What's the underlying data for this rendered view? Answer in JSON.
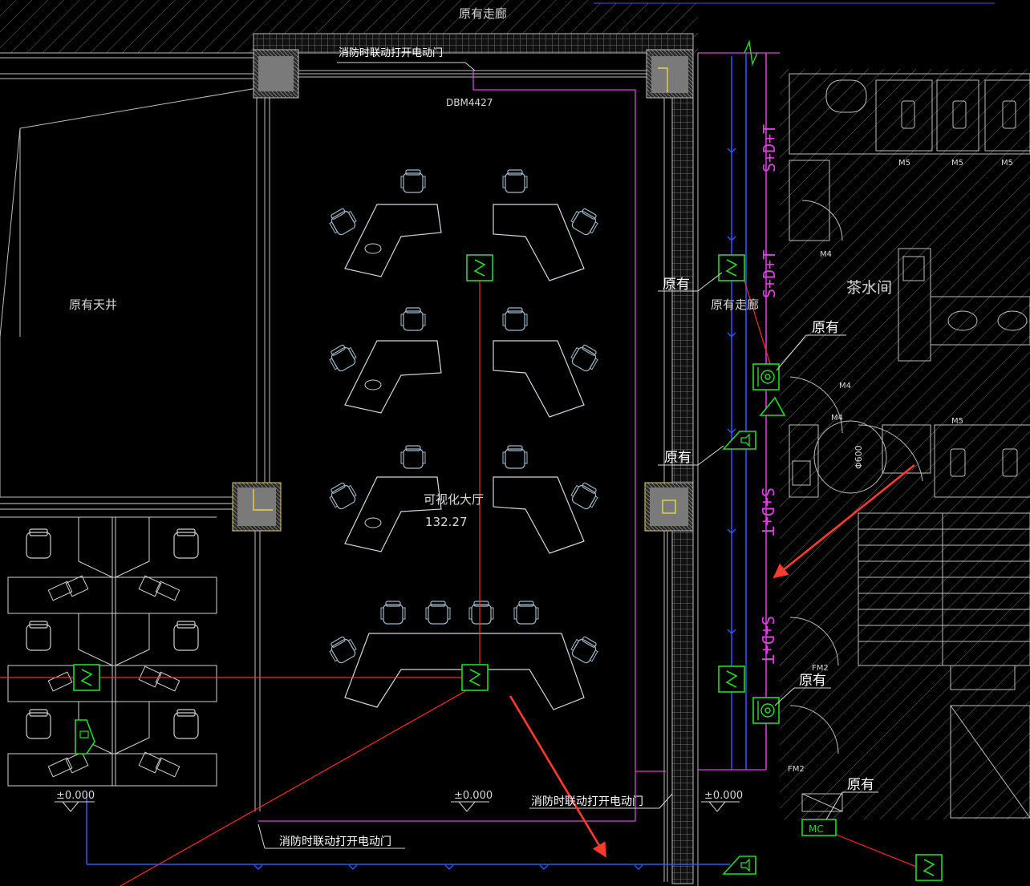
{
  "labels": {
    "corridor_top": "原有走廊",
    "atrium": "原有天井",
    "corridor_right": "原有走廊",
    "tea_room": "茶水间",
    "hall_name": "可视化大厅",
    "hall_area": "132.27",
    "door_tag": "DBM4427",
    "fire_door_top": "消防时联动打开电动门",
    "fire_door_bottom_left": "消防时联动打开电动门",
    "fire_door_bottom_mid": "消防时联动打开电动门",
    "existing_1": "原有",
    "existing_2": "原有",
    "existing_3": "原有",
    "existing_4": "原有",
    "existing_5": "原有",
    "level_1": "±0.000",
    "level_2": "±0.000",
    "level_3": "±0.000",
    "m5_a": "M5",
    "m5_b": "M5",
    "m5_c": "M5",
    "m4_a": "M4",
    "m4_b": "M4",
    "m4_c": "M4",
    "m5_d": "M5",
    "fm2_a": "FM2",
    "fm2_b": "FM2",
    "phi": "Φ600",
    "mc": "MC",
    "cable_1": "S+D+T",
    "cable_2": "S+D+T",
    "cable_3": "S+D+T",
    "cable_4": "S+D+T"
  },
  "colors": {
    "background": "#000000",
    "wall": "#bdbdbd",
    "hatch": "#6a6a6a",
    "furniture": "#cfd8dc",
    "chair": "#9fb8c8",
    "device_green": "#22dd22",
    "red_wire": "#ff2a2a",
    "blue_wire": "#3355ff",
    "magenta": "#e040e0",
    "text": "#d8d8d8",
    "annotation_arrow": "#ff3b30"
  },
  "icons": {
    "smoke_detector": "smoke-detector-icon",
    "speaker": "speaker-icon",
    "alarm_bell": "alarm-bell-icon",
    "manual_call_point": "manual-call-point-icon"
  }
}
